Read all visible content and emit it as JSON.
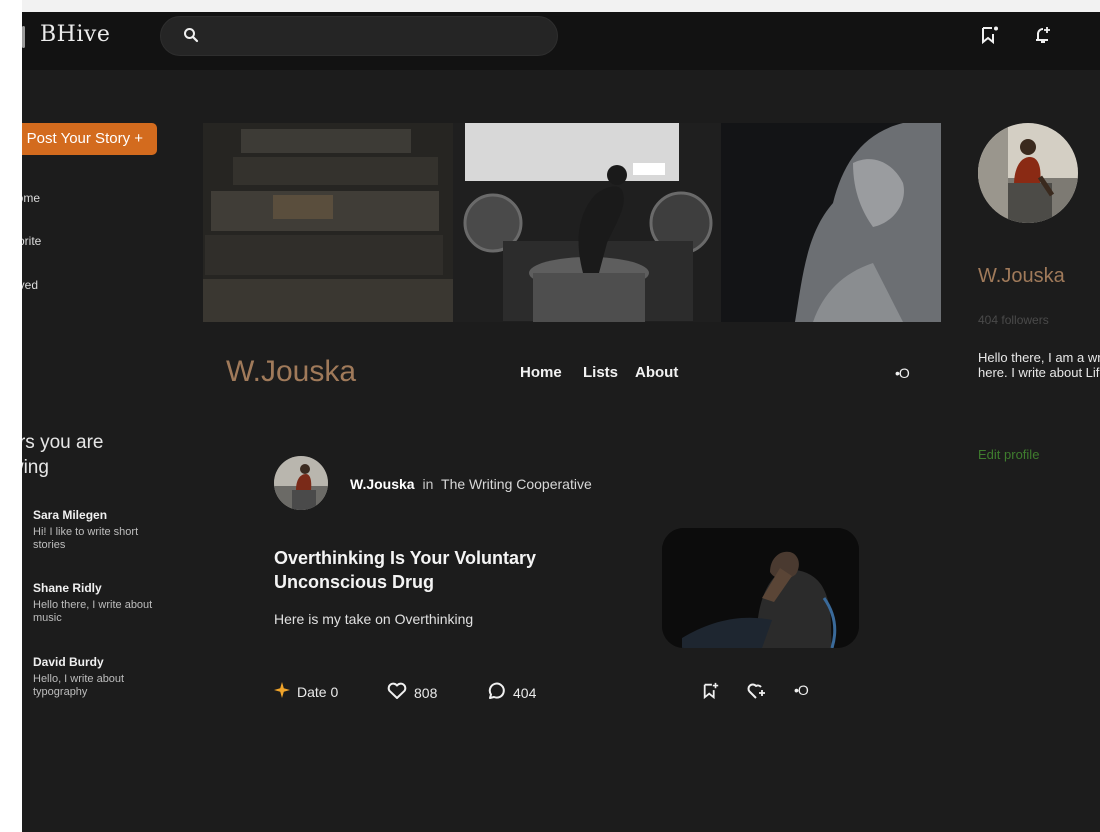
{
  "app": {
    "logo": "BHive"
  },
  "search": {
    "placeholder": ""
  },
  "sidebar": {
    "post_button": "Post Your Story +",
    "nav": [
      "Home",
      "Favorite",
      "Saved"
    ],
    "following_title": "Writers you are following",
    "following": [
      {
        "name": "Sara Milegen",
        "bio": "Hi! I like to write short stories"
      },
      {
        "name": "Shane Ridly",
        "bio": "Hello there, I write about music"
      },
      {
        "name": "David Burdy",
        "bio": "Hello, I write about typography"
      }
    ]
  },
  "profile": {
    "name": "W.Jouska",
    "nav": [
      "Home",
      "Lists",
      "About"
    ],
    "more": "•O"
  },
  "post": {
    "author": "W.Jouska",
    "in_word": "in",
    "publication": "The Writing Cooperative",
    "title": "Overthinking Is Your Voluntary Unconscious Drug",
    "subtitle": "Here is my take on Overthinking",
    "date": "Date 0",
    "likes": "808",
    "comments": "404",
    "more": "•O"
  },
  "right": {
    "name": "W.Jouska",
    "followers": "404 followers",
    "bio": "Hello there, I am a writer here. I write about Life",
    "edit": "Edit profile"
  },
  "colors": {
    "accent": "#d36b1e",
    "name": "#a07a5a",
    "edit": "#3f7d2e",
    "star": "#f0a42a"
  },
  "icons": [
    "search-icon",
    "bookmark-add-icon",
    "bell-add-icon",
    "star-icon",
    "heart-icon",
    "comment-icon",
    "follow-icon"
  ]
}
